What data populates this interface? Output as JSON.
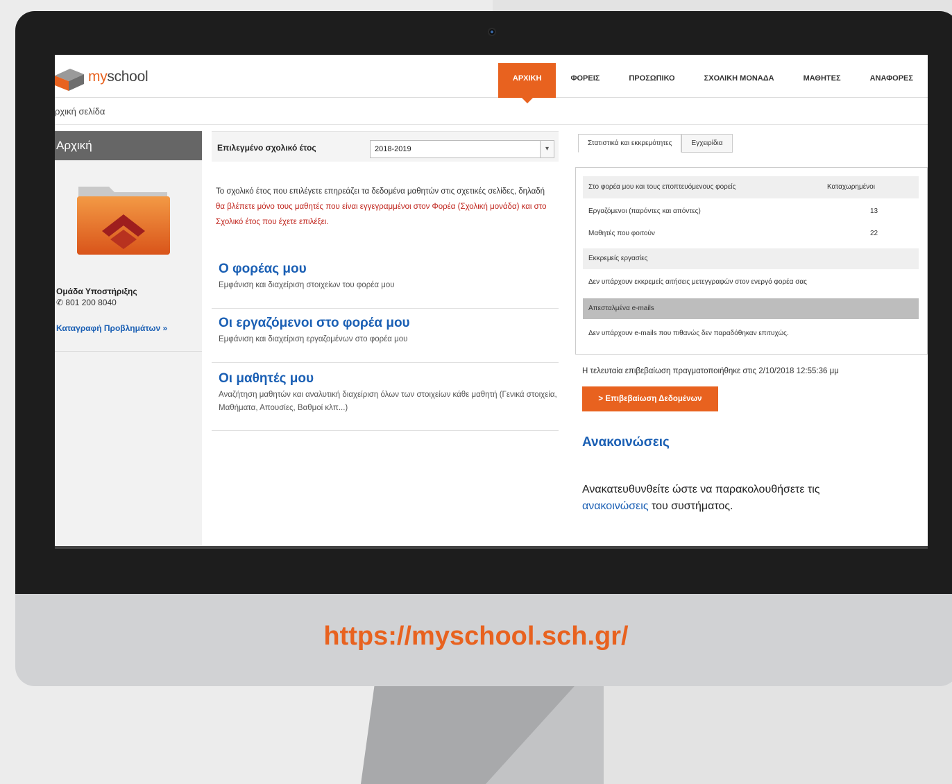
{
  "site": {
    "logo_my": "my",
    "logo_school": "school"
  },
  "nav": [
    "ΑΡΧΙΚΗ",
    "ΦΟΡΕΙΣ",
    "ΠΡΟΣΩΠΙΚΟ",
    "ΣΧΟΛΙΚΗ ΜΟΝΑΔΑ",
    "ΜΑΘΗΤΕΣ",
    "ΑΝΑΦΟΡΕΣ"
  ],
  "breadcrumb": "ρχική σελίδα",
  "sidebar": {
    "title": "Αρχική",
    "support_title": "Ομάδα Υποστήριξης",
    "support_phone": "801 200 8040",
    "problems_link": "Καταγραφή Προβλημάτων »"
  },
  "school_year": {
    "label": "Επιλεγμένο σχολικό έτος",
    "value": "2018-2019"
  },
  "intro": {
    "part1": "Το σχολικό έτος που επιλέγετε επηρεάζει τα δεδομένα μαθητών στις σχετικές σελίδες, δηλαδή ",
    "part2": "θα βλέπετε μόνο τους μαθητές που είναι εγγεγραμμένοι στον Φορέα (Σχολική μονάδα) και στο Σχολικό έτος που έχετε επιλέξει."
  },
  "links": [
    {
      "title": "Ο φορέας μου",
      "desc": "Εμφάνιση και διαχείριση στοιχείων του φορέα μου"
    },
    {
      "title": "Οι εργαζόμενοι στο φορέα μου",
      "desc": "Εμφάνιση και διαχείριση εργαζομένων στο φορέα μου"
    },
    {
      "title": "Οι μαθητές μου",
      "desc": "Αναζήτηση μαθητών και αναλυτική διαχείριση όλων των στοιχείων κάθε μαθητή (Γενικά στοιχεία, Μαθήματα, Απουσίες, Βαθμοί κλπ...)"
    }
  ],
  "tabs": [
    "Στατιστικά και εκκρεμότητες",
    "Εγχειρίδια"
  ],
  "stats": {
    "header_label": "Στο φορέα μου και τους εποπτευόμενους φορείς",
    "header_value": "Καταχωρημένοι",
    "employees_label": "Εργαζόμενοι (παρόντες και απόντες)",
    "employees_value": "13",
    "students_label": "Μαθητές που φοιτούν",
    "students_value": "22",
    "pending_title": "Εκκρεμείς εργασίες",
    "pending_text": "Δεν υπάρχουν εκκρεμείς αιτήσεις μετεγγραφών στον ενεργό φορέα σας",
    "emails_title": "Απεσταλμένα e-mails",
    "emails_text": "Δεν υπάρχουν e-mails που πιθανώς δεν παραδόθηκαν επιτυχώς."
  },
  "last_check": "Η τελευταία επιβεβαίωση πραγματοποιήθηκε στις 2/10/2018 12:55:36 μμ",
  "confirm_button": "> Επιβεβαίωση Δεδομένων",
  "announcements": {
    "title": "Ανακοινώσεις",
    "text_before": "Ανακατευθυνθείτε ώστε να παρακολουθήσετε τις ",
    "link": "ανακοινώσεις",
    "text_after": " του συστήματος."
  },
  "url": "https://myschool.sch.gr/",
  "colors": {
    "accent": "#e8621f",
    "link": "#1a5fb4",
    "alert": "#c0241c"
  }
}
